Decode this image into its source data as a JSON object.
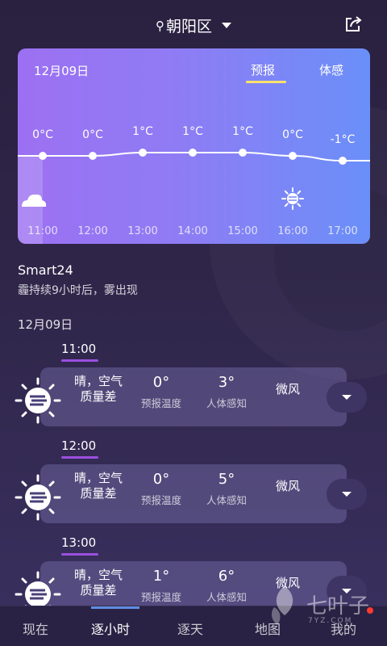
{
  "header": {
    "location": "朝阳区",
    "share_icon": "share-icon"
  },
  "card": {
    "date": "12月09日",
    "tabs": {
      "forecast": "预报",
      "feels": "体感"
    },
    "hours": [
      "11:00",
      "12:00",
      "13:00",
      "14:00",
      "15:00",
      "16:00",
      "17:00"
    ],
    "temps": [
      "0°C",
      "0°C",
      "1°C",
      "1°C",
      "1°C",
      "0°C",
      "-1°C"
    ]
  },
  "chart_data": {
    "type": "line",
    "x": [
      "11:00",
      "12:00",
      "13:00",
      "14:00",
      "15:00",
      "16:00",
      "17:00"
    ],
    "series": [
      {
        "values": [
          0,
          0,
          1,
          1,
          1,
          0,
          -1
        ]
      }
    ],
    "icons": {
      "11:00": "cloud-icon",
      "16:00": "sun-icon"
    },
    "ylabel": "",
    "xlabel": ""
  },
  "source": "Smart24",
  "summary": "霾持续9小时后，雾出现",
  "list_date": "12月09日",
  "rows": [
    {
      "time": "11:00",
      "cond1": "晴，空气",
      "cond2": "质量差",
      "temp": "0°",
      "temp_label": "预报温度",
      "feel": "3°",
      "feel_label": "人体感知",
      "wind": "微风"
    },
    {
      "time": "12:00",
      "cond1": "晴，空气",
      "cond2": "质量差",
      "temp": "0°",
      "temp_label": "预报温度",
      "feel": "5°",
      "feel_label": "人体感知",
      "wind": "微风"
    },
    {
      "time": "13:00",
      "cond1": "晴，空气",
      "cond2": "质量差",
      "temp": "1°",
      "temp_label": "预报温度",
      "feel": "6°",
      "feel_label": "人体感知",
      "wind": "微风"
    }
  ],
  "nav": [
    "现在",
    "逐小时",
    "逐天",
    "地图",
    "我的"
  ],
  "watermark": {
    "big": "七叶子",
    "small": "7YZ.COM"
  },
  "colors": {
    "accent": "#ffe26a",
    "underline": "#9b4fe0",
    "badge": "#ff3b30"
  }
}
